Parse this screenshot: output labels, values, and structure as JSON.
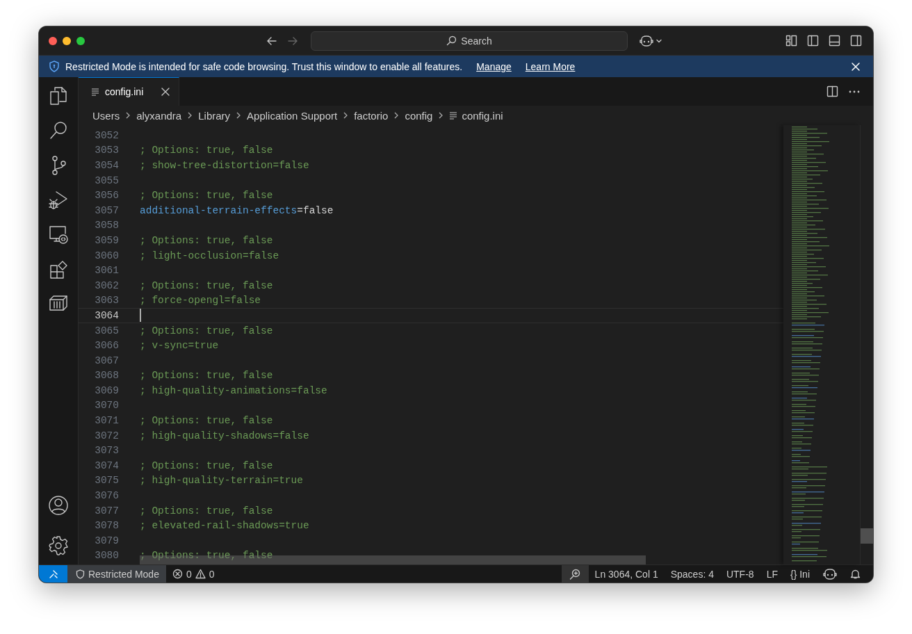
{
  "command_center": {
    "label": "Search"
  },
  "banner": {
    "text": "Restricted Mode is intended for safe code browsing. Trust this window to enable all features.",
    "links": [
      "Manage",
      "Learn More"
    ]
  },
  "tabs": [
    {
      "label": "config.ini",
      "selected": true
    }
  ],
  "breadcrumbs": [
    {
      "label": "Users",
      "kind": "folder"
    },
    {
      "label": "alyxandra",
      "kind": "folder"
    },
    {
      "label": "Library",
      "kind": "folder"
    },
    {
      "label": "Application Support",
      "kind": "folder"
    },
    {
      "label": "factorio",
      "kind": "folder"
    },
    {
      "label": "config",
      "kind": "folder"
    },
    {
      "label": "config.ini",
      "kind": "file"
    }
  ],
  "editor": {
    "lines": [
      {
        "number": "3052",
        "kind": "empty",
        "current": false
      },
      {
        "number": "3053",
        "kind": "comment",
        "text": "; Options: true, false",
        "current": false
      },
      {
        "number": "3054",
        "kind": "comment",
        "text": "; show-tree-distortion=false",
        "current": false
      },
      {
        "number": "3055",
        "kind": "empty",
        "current": false
      },
      {
        "number": "3056",
        "kind": "comment",
        "text": "; Options: true, false",
        "current": false
      },
      {
        "number": "3057",
        "kind": "setting",
        "key": "additional-terrain-effects",
        "value": "=false",
        "current": false
      },
      {
        "number": "3058",
        "kind": "empty",
        "current": false
      },
      {
        "number": "3059",
        "kind": "comment",
        "text": "; Options: true, false",
        "current": false
      },
      {
        "number": "3060",
        "kind": "comment",
        "text": "; light-occlusion=false",
        "current": false
      },
      {
        "number": "3061",
        "kind": "empty",
        "current": false
      },
      {
        "number": "3062",
        "kind": "comment",
        "text": "; Options: true, false",
        "current": false
      },
      {
        "number": "3063",
        "kind": "comment",
        "text": "; force-opengl=false",
        "current": false
      },
      {
        "number": "3064",
        "kind": "empty",
        "current": true
      },
      {
        "number": "3065",
        "kind": "comment",
        "text": "; Options: true, false",
        "current": false
      },
      {
        "number": "3066",
        "kind": "comment",
        "text": "; v-sync=true",
        "current": false
      },
      {
        "number": "3067",
        "kind": "empty",
        "current": false
      },
      {
        "number": "3068",
        "kind": "comment",
        "text": "; Options: true, false",
        "current": false
      },
      {
        "number": "3069",
        "kind": "comment",
        "text": "; high-quality-animations=false",
        "current": false
      },
      {
        "number": "3070",
        "kind": "empty",
        "current": false
      },
      {
        "number": "3071",
        "kind": "comment",
        "text": "; Options: true, false",
        "current": false
      },
      {
        "number": "3072",
        "kind": "comment",
        "text": "; high-quality-shadows=false",
        "current": false
      },
      {
        "number": "3073",
        "kind": "empty",
        "current": false
      },
      {
        "number": "3074",
        "kind": "comment",
        "text": "; Options: true, false",
        "current": false
      },
      {
        "number": "3075",
        "kind": "comment",
        "text": "; high-quality-terrain=true",
        "current": false
      },
      {
        "number": "3076",
        "kind": "empty",
        "current": false
      },
      {
        "number": "3077",
        "kind": "comment",
        "text": "; Options: true, false",
        "current": false
      },
      {
        "number": "3078",
        "kind": "comment",
        "text": "; elevated-rail-shadows=true",
        "current": false
      },
      {
        "number": "3079",
        "kind": "empty",
        "current": false
      },
      {
        "number": "3080",
        "kind": "comment",
        "text": "; Options: true, false",
        "current": false
      }
    ]
  },
  "status_bar": {
    "restricted": "Restricted Mode",
    "errors": "0",
    "warnings": "0",
    "position": "Ln 3064, Col 1",
    "indent": "Spaces: 4",
    "encoding": "UTF-8",
    "eol": "LF",
    "language_icon": "{}",
    "language": "Ini"
  }
}
